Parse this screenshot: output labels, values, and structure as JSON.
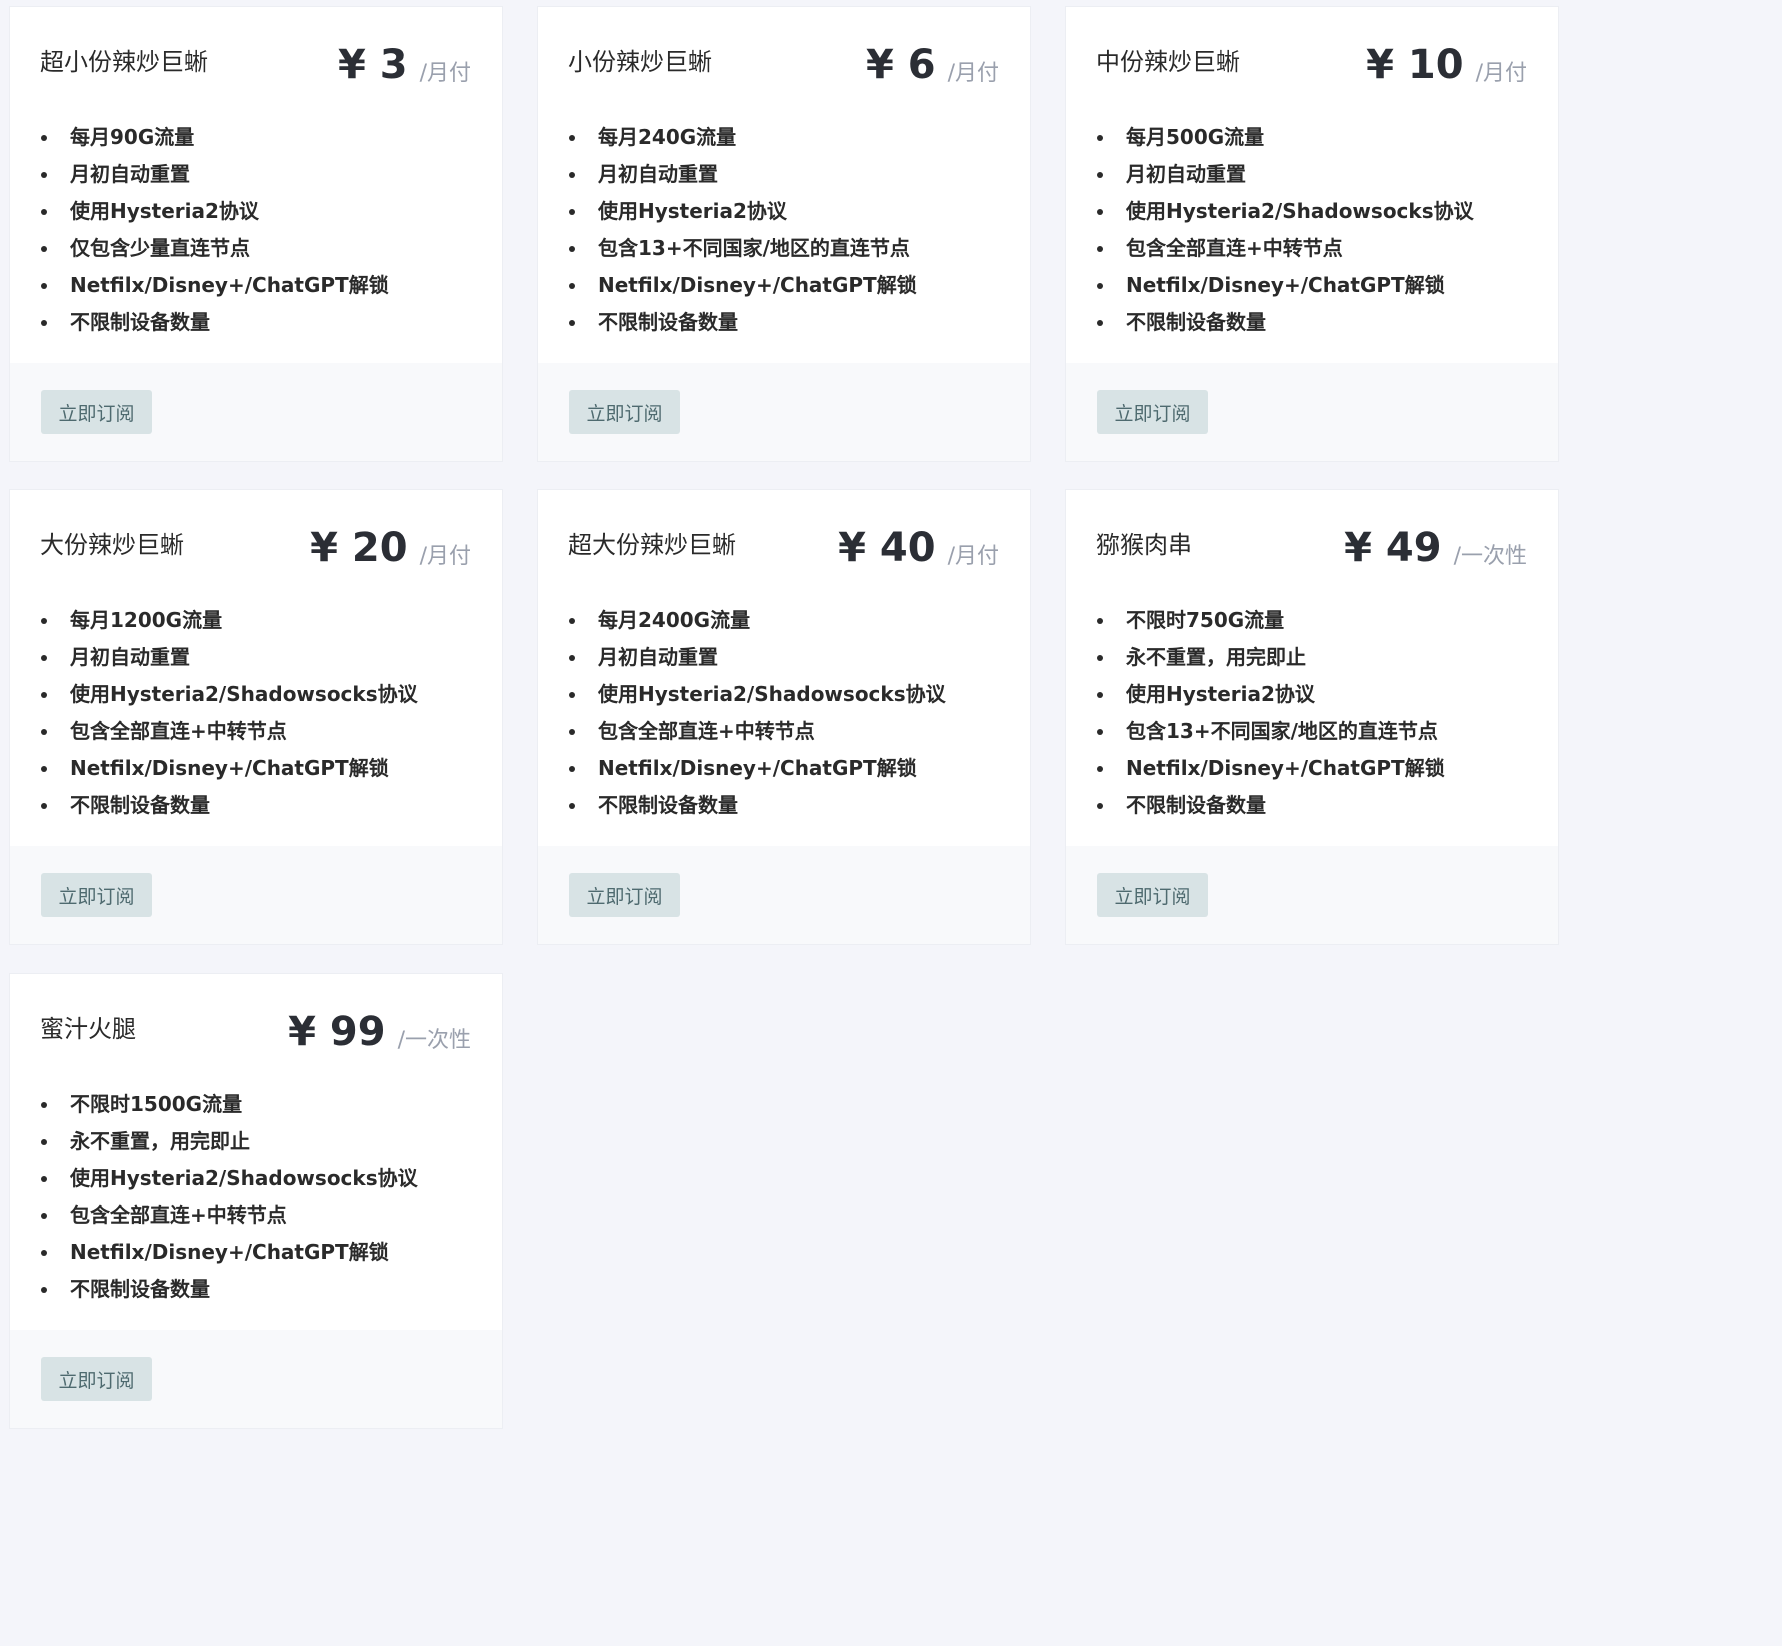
{
  "plans": [
    {
      "title": "超小份辣炒巨蜥",
      "price": "¥ 3",
      "unit": "/月付",
      "features": [
        "每月90G流量",
        "月初自动重置",
        "使用Hysteria2协议",
        "仅包含少量直连节点",
        "Netfilx/Disney+/ChatGPT解锁",
        "不限制设备数量"
      ],
      "button": "立即订阅"
    },
    {
      "title": "小份辣炒巨蜥",
      "price": "¥ 6",
      "unit": "/月付",
      "features": [
        "每月240G流量",
        "月初自动重置",
        "使用Hysteria2协议",
        "包含13+不同国家/地区的直连节点",
        "Netfilx/Disney+/ChatGPT解锁",
        "不限制设备数量"
      ],
      "button": "立即订阅"
    },
    {
      "title": "中份辣炒巨蜥",
      "price": "¥ 10",
      "unit": "/月付",
      "features": [
        "每月500G流量",
        "月初自动重置",
        "使用Hysteria2/Shadowsocks协议",
        "包含全部直连+中转节点",
        "Netfilx/Disney+/ChatGPT解锁",
        "不限制设备数量"
      ],
      "button": "立即订阅"
    },
    {
      "title": "大份辣炒巨蜥",
      "price": "¥ 20",
      "unit": "/月付",
      "features": [
        "每月1200G流量",
        "月初自动重置",
        "使用Hysteria2/Shadowsocks协议",
        "包含全部直连+中转节点",
        "Netfilx/Disney+/ChatGPT解锁",
        "不限制设备数量"
      ],
      "button": "立即订阅"
    },
    {
      "title": "超大份辣炒巨蜥",
      "price": "¥ 40",
      "unit": "/月付",
      "features": [
        "每月2400G流量",
        "月初自动重置",
        "使用Hysteria2/Shadowsocks协议",
        "包含全部直连+中转节点",
        "Netfilx/Disney+/ChatGPT解锁",
        "不限制设备数量"
      ],
      "button": "立即订阅"
    },
    {
      "title": "猕猴肉串",
      "price": "¥ 49",
      "unit": "/一次性",
      "features": [
        "不限时750G流量",
        "永不重置，用完即止",
        "使用Hysteria2协议",
        "包含13+不同国家/地区的直连节点",
        "Netfilx/Disney+/ChatGPT解锁",
        "不限制设备数量"
      ],
      "button": "立即订阅"
    },
    {
      "title": "蜜汁火腿",
      "price": "¥ 99",
      "unit": "/一次性",
      "features": [
        "不限时1500G流量",
        "永不重置，用完即止",
        "使用Hysteria2/Shadowsocks协议",
        "包含全部直连+中转节点",
        "Netfilx/Disney+/ChatGPT解锁",
        "不限制设备数量"
      ],
      "button": "立即订阅"
    }
  ]
}
